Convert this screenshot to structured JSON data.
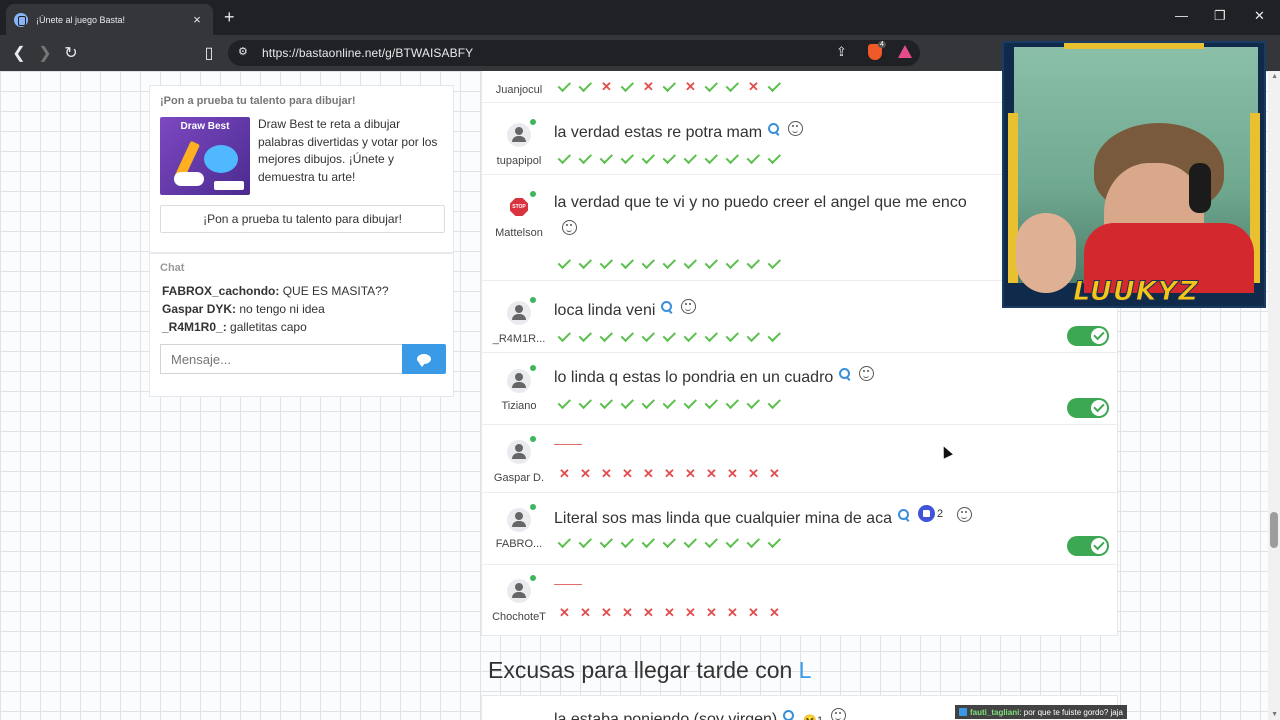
{
  "browser": {
    "tab_title": "¡Únete al juego Basta!",
    "url": "https://bastaonline.net/g/BTWAISABFY",
    "brave_badge": "4"
  },
  "promo": {
    "heading": "¡Pon a prueba tu talento para dibujar!",
    "image_title": "Draw Best",
    "description": "Draw Best te reta a dibujar palabras divertidas y votar por los mejores dibujos. ¡Únete y demuestra tu arte!",
    "button_label": "¡Pon a prueba tu talento para dibujar!"
  },
  "chat": {
    "heading": "Chat",
    "messages": [
      {
        "user": "FABROX_cachondo:",
        "text": "QUE ES MASITA??"
      },
      {
        "user": "Gaspar DYK:",
        "text": "no tengo ni idea"
      },
      {
        "user": "_R4M1R0_:",
        "text": "galletitas capo"
      }
    ],
    "input_placeholder": "Mensaje..."
  },
  "answers": [
    {
      "player": "Juanjocul",
      "text": "",
      "marks": [
        "ok",
        "ok",
        "bad",
        "ok",
        "bad",
        "ok",
        "bad",
        "ok",
        "ok",
        "bad",
        "ok"
      ],
      "toggle": false
    },
    {
      "player": "tupapipol",
      "text": "la verdad estas re potra mam",
      "marks": [
        "ok",
        "ok",
        "ok",
        "ok",
        "ok",
        "ok",
        "ok",
        "ok",
        "ok",
        "ok",
        "ok"
      ],
      "toggle": false
    },
    {
      "player": "Mattelson",
      "text": "la verdad que te vi y no puedo creer el angel que me enco",
      "marks": [
        "ok",
        "ok",
        "ok",
        "ok",
        "ok",
        "ok",
        "ok",
        "ok",
        "ok",
        "ok",
        "ok"
      ],
      "toggle": false
    },
    {
      "player": "_R4M1R...",
      "text": "loca linda veni",
      "marks": [
        "ok",
        "ok",
        "ok",
        "ok",
        "ok",
        "ok",
        "ok",
        "ok",
        "ok",
        "ok",
        "ok"
      ],
      "toggle": true
    },
    {
      "player": "Tiziano",
      "text": "lo linda q estas lo pondria en un cuadro",
      "marks": [
        "ok",
        "ok",
        "ok",
        "ok",
        "ok",
        "ok",
        "ok",
        "ok",
        "ok",
        "ok",
        "ok"
      ],
      "toggle": true
    },
    {
      "player": "Gaspar D.",
      "text": "",
      "marks": [
        "bad",
        "bad",
        "bad",
        "bad",
        "bad",
        "bad",
        "bad",
        "bad",
        "bad",
        "bad",
        "bad"
      ],
      "toggle": false
    },
    {
      "player": "FABRO...",
      "text": "Literal sos mas linda que cualquier mina de aca",
      "likes": "2",
      "marks": [
        "ok",
        "ok",
        "ok",
        "ok",
        "ok",
        "ok",
        "ok",
        "ok",
        "ok",
        "ok",
        "ok"
      ],
      "toggle": true
    },
    {
      "player": "ChochoteT",
      "text": "",
      "marks": [
        "bad",
        "bad",
        "bad",
        "bad",
        "bad",
        "bad",
        "bad",
        "bad",
        "bad",
        "bad",
        "bad"
      ],
      "toggle": false
    }
  ],
  "next_section": {
    "heading": "Excusas para llegar tarde con",
    "letter": "L",
    "first_answer": "la estaba poniendo (soy virgen)",
    "first_reaction_count": "1"
  },
  "webcam": {
    "streamer_name": "LUUKYZ"
  },
  "stream_chat": {
    "user": "fauti_tagliani",
    "text": ": por que te fuiste gordo? jaja"
  }
}
